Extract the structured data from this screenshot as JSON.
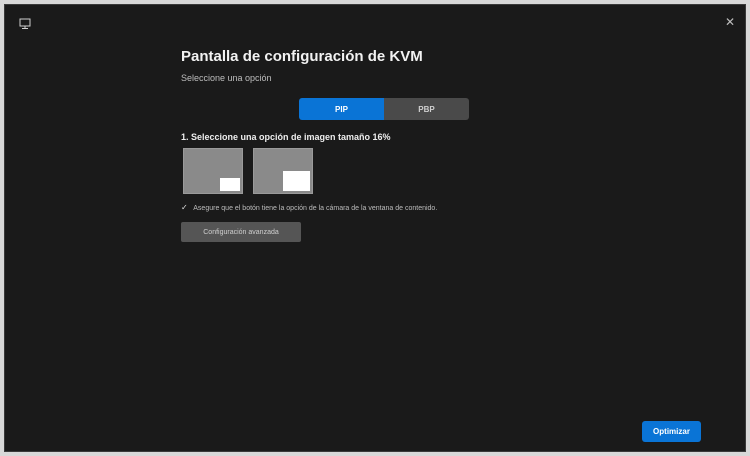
{
  "window": {
    "title": "Pantalla de configuración de KVM",
    "subtitle": "Seleccione una opción",
    "close_glyph": "✕"
  },
  "icons": {
    "app": "monitor-icon",
    "close": "close-icon",
    "check": "checkmark-icon"
  },
  "mode_tabs": [
    {
      "label": "PIP",
      "selected": true
    },
    {
      "label": "PBP",
      "selected": false
    }
  ],
  "section": {
    "label": "1. Seleccione una opción de imagen tamaño 16%"
  },
  "layout_options": [
    {
      "name": "pip-small",
      "selected": false
    },
    {
      "name": "pip-large",
      "selected": false
    }
  ],
  "hint": {
    "check_glyph": "✓",
    "text": "Asegure que el botón tiene la opción de la cámara de la ventana de contenido."
  },
  "configure_button": {
    "label": "Configuración avanzada"
  },
  "optimize_button": {
    "label": "Optimizar"
  },
  "colors": {
    "accent": "#0a74d6",
    "background": "#1a1a1a",
    "button_secondary": "#555555"
  }
}
